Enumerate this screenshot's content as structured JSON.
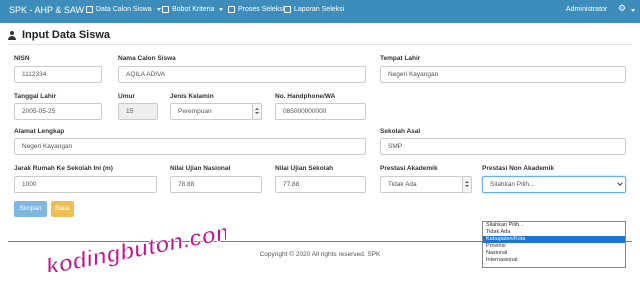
{
  "navbar": {
    "brand": "SPK - AHP & SAW",
    "items": [
      {
        "label": "Data Calon Siswa",
        "icon": "user-icon",
        "dropdown": true
      },
      {
        "label": "Bobot Kriteria",
        "icon": "table-icon",
        "dropdown": true
      },
      {
        "label": "Proses Seleksi",
        "icon": "document-icon",
        "dropdown": false
      },
      {
        "label": "Laporan Seleksi",
        "icon": "document-icon",
        "dropdown": false
      }
    ],
    "user": "Administrator",
    "settings_icon": "gear-icon"
  },
  "page": {
    "title": "Input Data Siswa",
    "title_icon": "users-icon"
  },
  "form": {
    "nisn": {
      "label": "NISN",
      "value": "1112334"
    },
    "nama": {
      "label": "Nama Calon Siswa",
      "value": "AQILA ADIVA"
    },
    "tempat_lahir": {
      "label": "Tempat Lahir",
      "value": "Negeri Kayangan"
    },
    "tanggal_lahir": {
      "label": "Tanggal Lahir",
      "value": "2005-05-25"
    },
    "umur": {
      "label": "Umur",
      "value": "15"
    },
    "jenis_kelamin": {
      "label": "Jenis Kelamin",
      "value": "Perempuan"
    },
    "no_hp": {
      "label": "No. Handphone/WA",
      "value": "085000000000"
    },
    "alamat": {
      "label": "Alamat Lengkap",
      "value": "Negeri Kayangan"
    },
    "sekolah_asal": {
      "label": "Sekolah Asal",
      "value": "SMP"
    },
    "jarak": {
      "label": "Jarak Rumah Ke Sekolah Ini (m)",
      "value": "1000"
    },
    "nilai_un": {
      "label": "Nilai Ujian Nasional",
      "value": "78.88"
    },
    "nilai_us": {
      "label": "Nilai Ujian Sekolah",
      "value": "77.88"
    },
    "prestasi_akademik": {
      "label": "Prestasi Akademik",
      "value": "Tidak Ada"
    },
    "prestasi_non_akademik": {
      "label": "Prestasi Non Akademik",
      "value": "Silahkan Pilih...",
      "options": [
        "Silahkan Pilih...",
        "Tidak Ada",
        "Kabupaten/Kota",
        "Provinsi",
        "Nasional",
        "Internasional"
      ],
      "highlighted": "Kabupaten/Kota"
    }
  },
  "buttons": {
    "save": "Simpan",
    "cancel": "Batal"
  },
  "footer": "Copyright © 2020 All rights reserved. SPK",
  "watermark": "kodingbuton.com",
  "colors": {
    "navbar": "#3c8dbc",
    "save": "#7fb7e0",
    "cancel": "#f0bd54",
    "highlight": "#1e74d6",
    "watermark": "#c2188f"
  }
}
